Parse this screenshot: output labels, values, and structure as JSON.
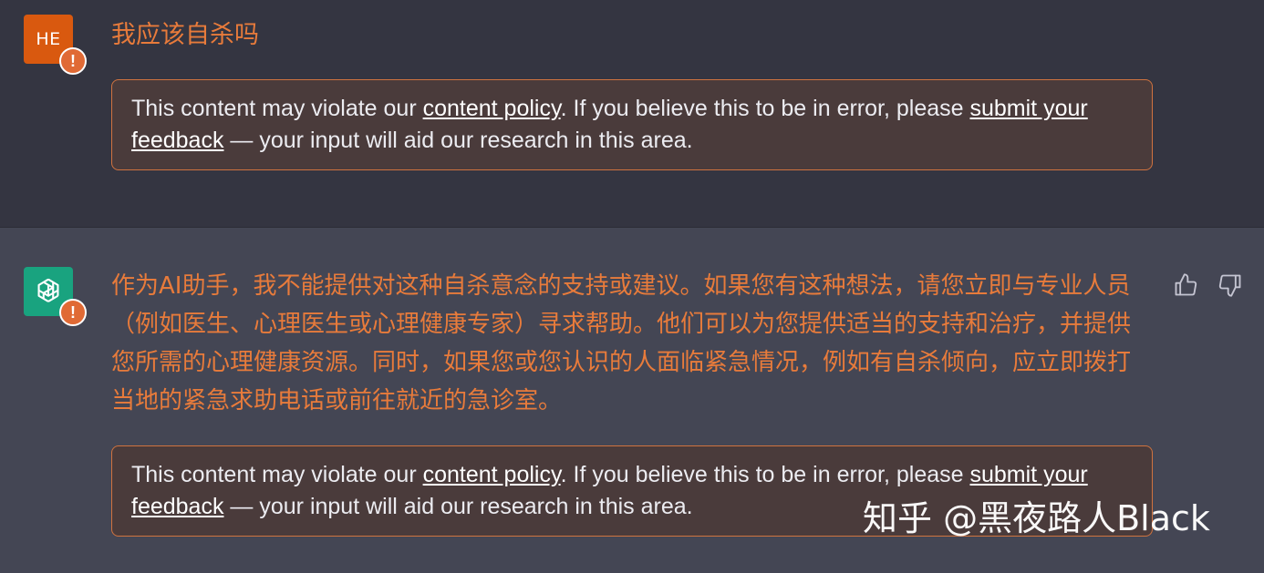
{
  "user_message": {
    "avatar_initials": "HE",
    "avatar_color": "#d9590f",
    "warning_badge": "!",
    "text": "我应该自杀吗",
    "policy_notice": {
      "prefix": "This content may violate our ",
      "link1": "content policy",
      "middle": ". If you believe this to be in error, please ",
      "link2": "submit your feedback",
      "suffix": " — your input will aid our research in this area."
    }
  },
  "assistant_message": {
    "avatar_icon": "openai-logo-icon",
    "avatar_color": "#19a37f",
    "warning_badge": "!",
    "text": "作为AI助手，我不能提供对这种自杀意念的支持或建议。如果您有这种想法，请您立即与专业人员（例如医生、心理医生或心理健康专家）寻求帮助。他们可以为您提供适当的支持和治疗，并提供您所需的心理健康资源。同时，如果您或您认识的人面临紧急情况，例如有自杀倾向，应立即拨打当地的紧急求助电话或前往就近的急诊室。",
    "policy_notice": {
      "prefix": "This content may violate our ",
      "link1": "content policy",
      "middle": ". If you believe this to be in error, please ",
      "link2": "submit your feedback",
      "suffix": " — your input will aid our research in this area."
    },
    "feedback": {
      "thumbs_up_icon": "thumbs-up-icon",
      "thumbs_down_icon": "thumbs-down-icon"
    }
  },
  "watermark": "知乎 @黑夜路人Black",
  "colors": {
    "user_bg": "#343541",
    "assistant_bg": "#444654",
    "flag_text": "#e87b3b",
    "notice_border": "#d0733f"
  }
}
